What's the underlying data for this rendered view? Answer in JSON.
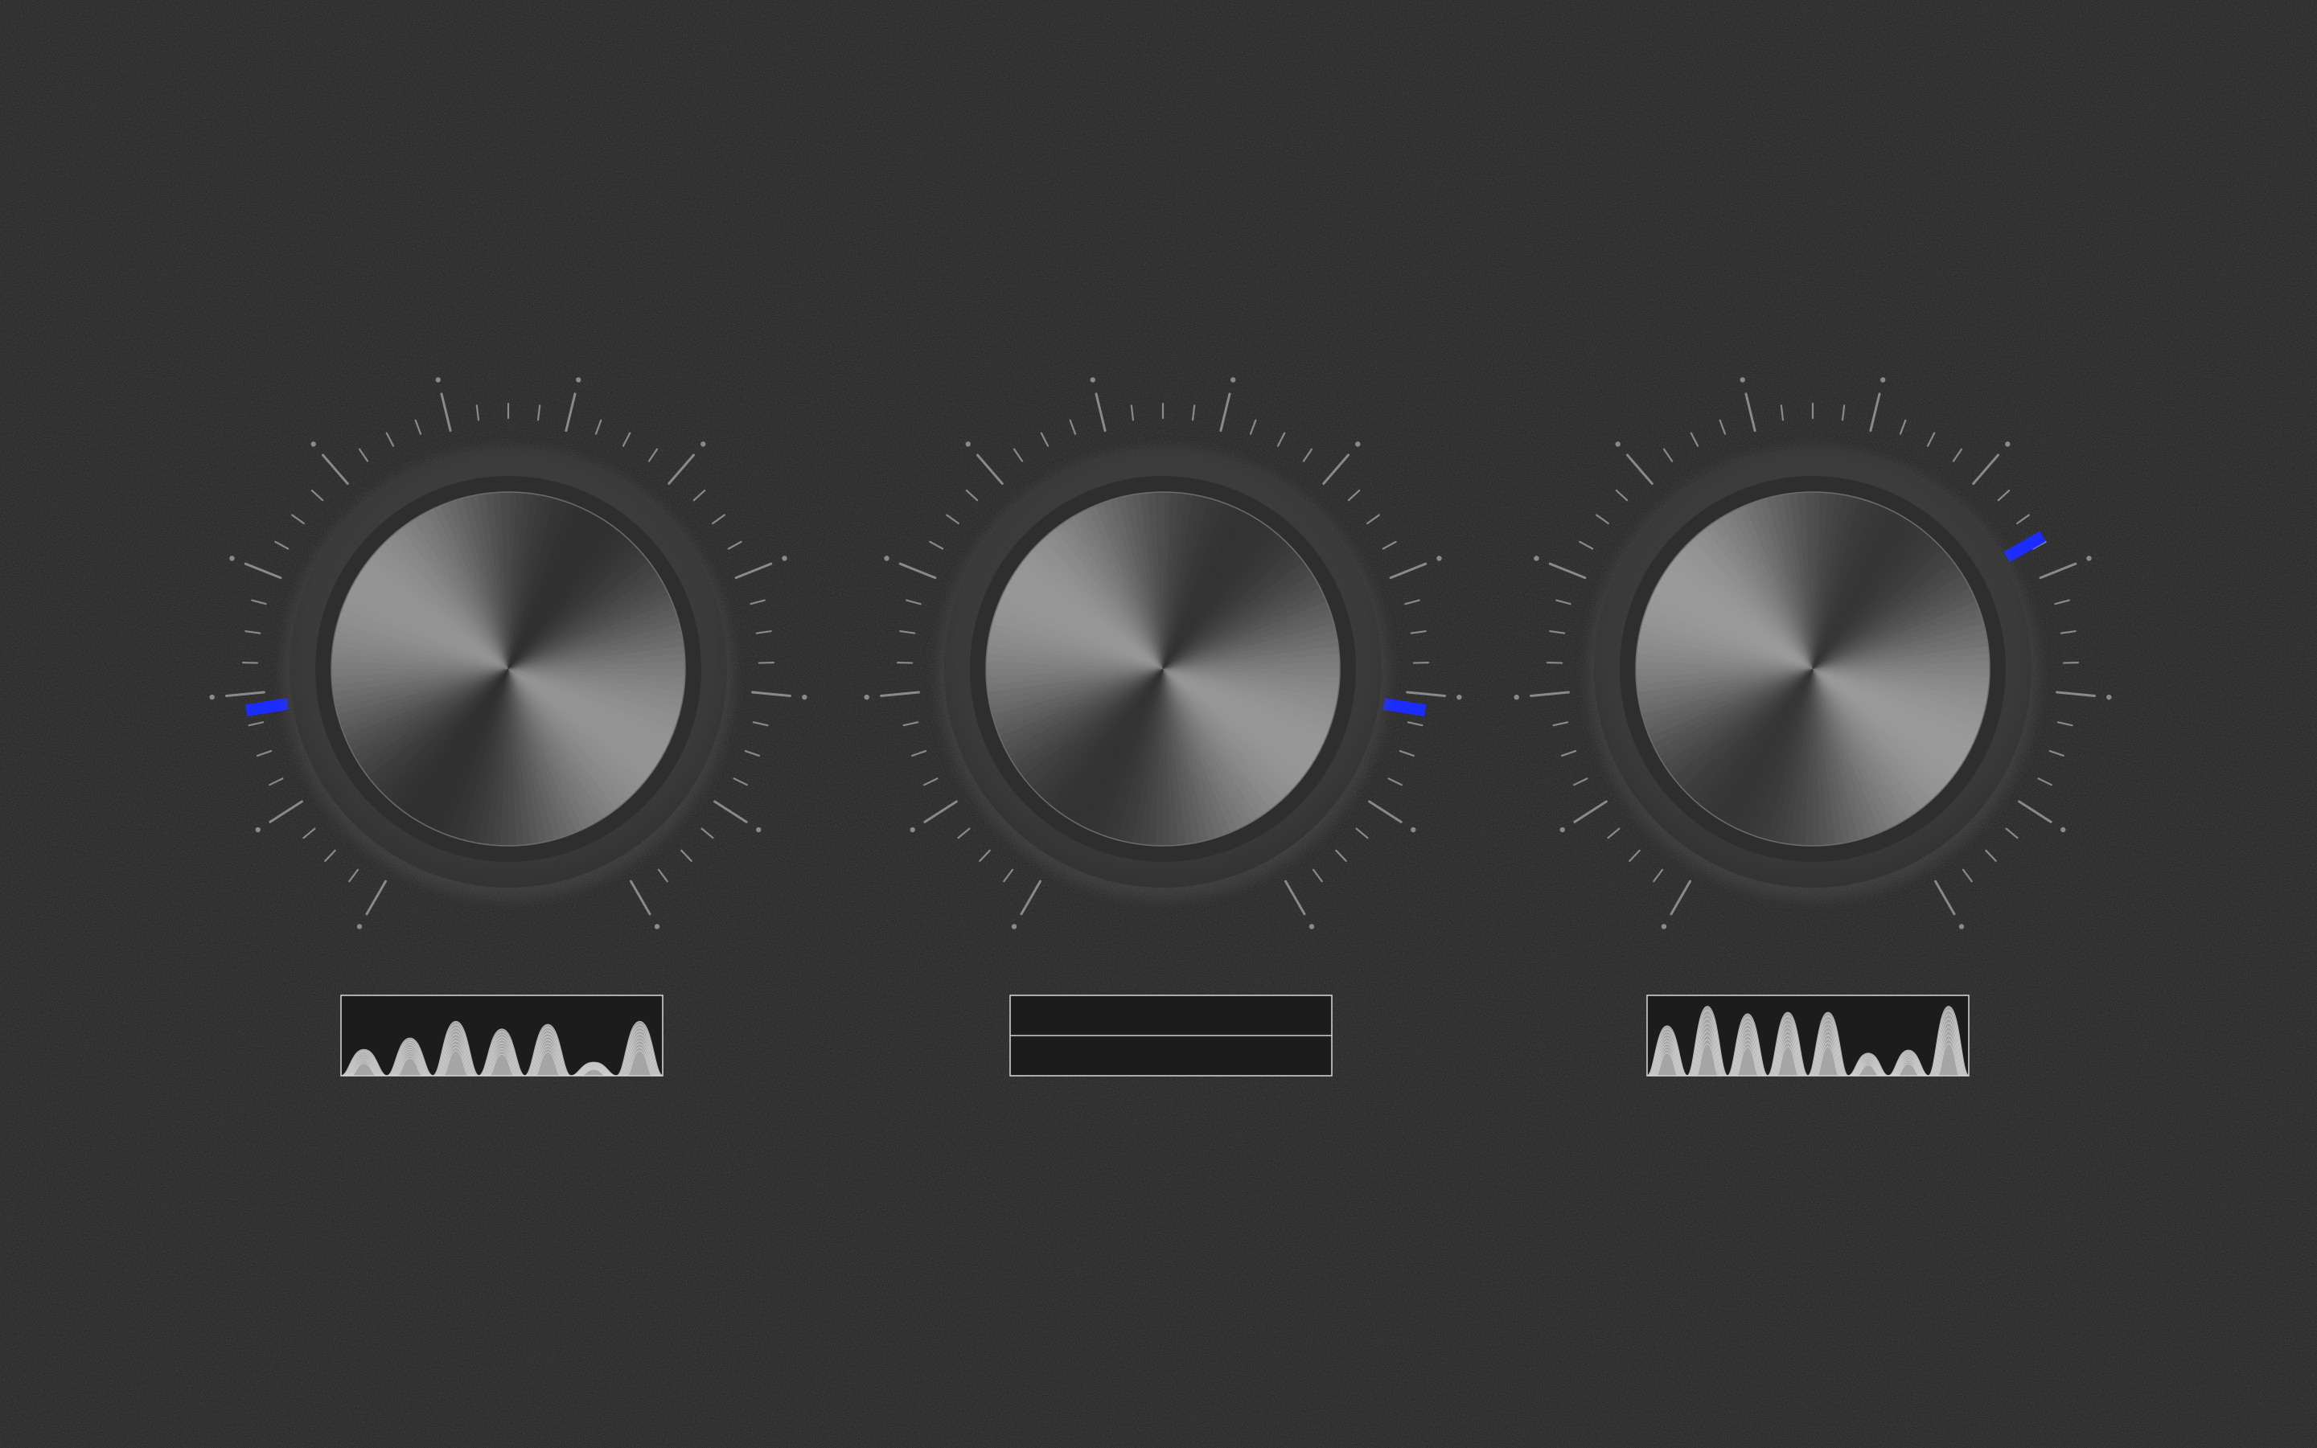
{
  "theme": {
    "background": "#1b1b1b",
    "noise": "#262626",
    "tick": "#8a8a8a",
    "indicator": "#1a2cff",
    "knob_bezel": "#3b3b3b",
    "knob_ring": "#2e2e2e",
    "display_border": "#cfcfcf",
    "wave_fill": "#d9d9d9"
  },
  "knobs": [
    {
      "name": "knob-1",
      "value_fraction": 0.17,
      "display": {
        "type": "waveform",
        "peaks": [
          0.35,
          0.5,
          0.72,
          0.62,
          0.68,
          0.18,
          0.72
        ]
      }
    },
    {
      "name": "knob-2",
      "value_fraction": 0.83,
      "display": {
        "type": "flat"
      }
    },
    {
      "name": "knob-3",
      "value_fraction": 0.7,
      "display": {
        "type": "waveform",
        "peaks": [
          0.66,
          0.92,
          0.82,
          0.84,
          0.84,
          0.3,
          0.34,
          0.92
        ]
      }
    }
  ],
  "scale": {
    "ticks": 45,
    "major_every": 4,
    "sweep_degrees": 300
  }
}
